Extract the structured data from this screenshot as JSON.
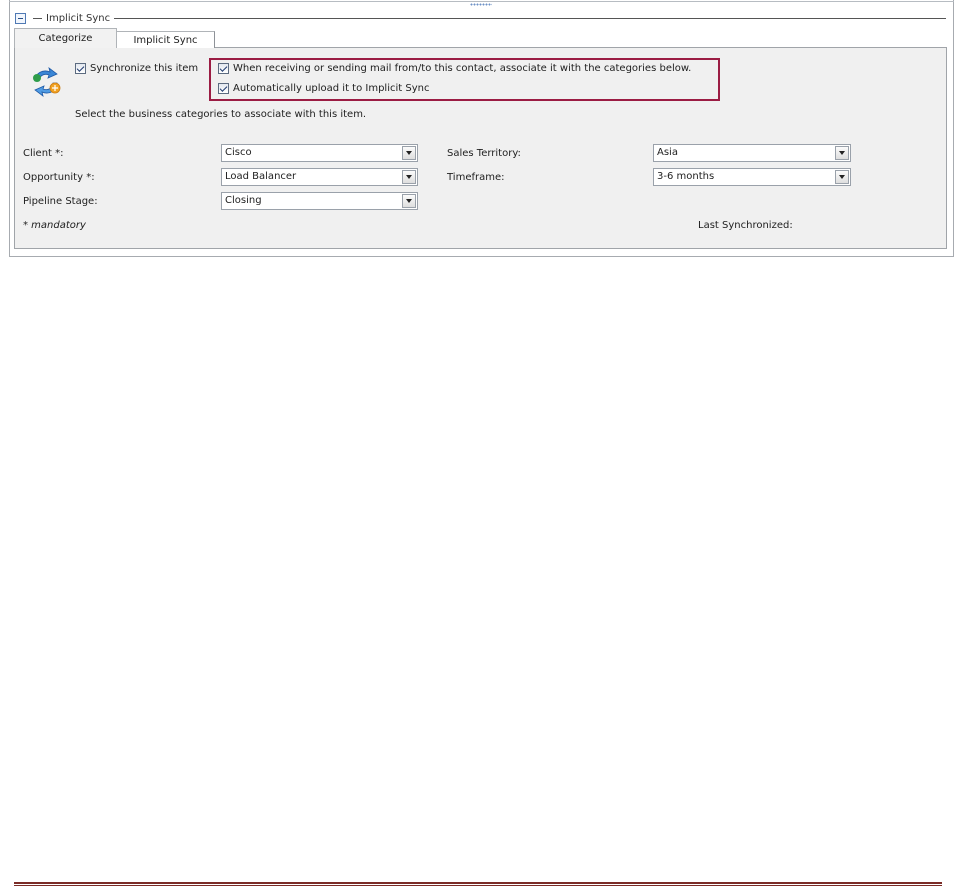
{
  "section": {
    "title": "Implicit Sync"
  },
  "tabs": [
    {
      "label": "Categorize",
      "active": true
    },
    {
      "label": "Implicit Sync",
      "active": false
    }
  ],
  "options": {
    "synchronize": {
      "label": "Synchronize this item",
      "checked": true
    },
    "associate_categories": {
      "label": "When receiving or sending mail from/to this contact, associate it with the categories below.",
      "checked": true
    },
    "auto_upload": {
      "label": "Automatically upload it to Implicit Sync",
      "checked": true
    }
  },
  "hint": "Select the business categories to associate with this item.",
  "fields": {
    "client": {
      "label": "Client *:",
      "value": "Cisco"
    },
    "opportunity": {
      "label": "Opportunity *:",
      "value": "Load Balancer"
    },
    "pipeline_stage": {
      "label": "Pipeline Stage:",
      "value": "Closing"
    },
    "sales_territory": {
      "label": "Sales Territory:",
      "value": "Asia"
    },
    "timeframe": {
      "label": "Timeframe:",
      "value": "3-6 months"
    }
  },
  "footer": {
    "mandatory_note": "* mandatory",
    "last_synchronized_label": "Last Synchronized:"
  },
  "colors": {
    "highlight_border": "#9b1c43",
    "page_rule": "#7b2c27",
    "panel_background": "#f0f0f0"
  },
  "icons": {
    "section_toggle": "collapse-icon",
    "sync": "sync-arrows-icon",
    "dropdown": "chevron-down-icon"
  }
}
